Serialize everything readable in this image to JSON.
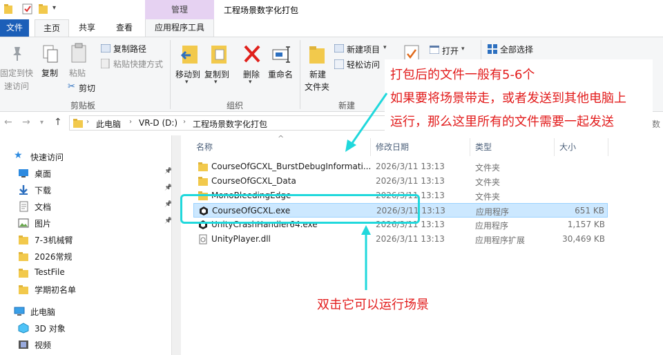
{
  "window": {
    "title": "工程场景数字化打包",
    "context_tab": "管理"
  },
  "ribbon_tabs": {
    "file": "文件",
    "home": "主页",
    "share": "共享",
    "view": "查看",
    "app_tools": "应用程序工具"
  },
  "ribbon": {
    "pin_quick_access": [
      "固定到快",
      "速访问"
    ],
    "copy": "复制",
    "paste": "粘贴",
    "copy_path": "复制路径",
    "paste_shortcut": "粘贴快捷方式",
    "cut": "剪切",
    "clipboard_group": "剪贴板",
    "move_to": "移动到",
    "copy_to": "复制到",
    "delete": "删除",
    "rename": "重命名",
    "organize_group": "组织",
    "new_folder": [
      "新建",
      "文件夹"
    ],
    "new_item": "新建项目",
    "easy_access": "轻松访问",
    "new_group": "新建",
    "open": "打开",
    "select_all": "全部选择"
  },
  "address": {
    "crumbs": [
      "此电脑",
      "VR-D (D:)",
      "工程场景数字化打包"
    ],
    "search_peek": "数"
  },
  "nav": {
    "quick_access": "快速访问",
    "items": [
      {
        "label": "桌面",
        "pinned": true
      },
      {
        "label": "下载",
        "pinned": true
      },
      {
        "label": "文档",
        "pinned": true
      },
      {
        "label": "图片",
        "pinned": true
      },
      {
        "label": "7-3机械臂",
        "pinned": false
      },
      {
        "label": "2026常规",
        "pinned": false
      },
      {
        "label": "TestFile",
        "pinned": false
      },
      {
        "label": "学期初名单",
        "pinned": false
      }
    ],
    "this_pc": "此电脑",
    "pc_items": [
      {
        "label": "3D 对象"
      },
      {
        "label": "视频"
      }
    ]
  },
  "columns": {
    "name": "名称",
    "date": "修改日期",
    "type": "类型",
    "size": "大小"
  },
  "files": [
    {
      "name": "CourseOfGCXL_BurstDebugInformati...",
      "date": "2026/3/11 13:13",
      "type": "文件夹",
      "size": "",
      "kind": "folder"
    },
    {
      "name": "CourseOfGCXL_Data",
      "date": "2026/3/11 13:13",
      "type": "文件夹",
      "size": "",
      "kind": "folder"
    },
    {
      "name": "MonoBleedingEdge",
      "date": "2026/3/11 13:13",
      "type": "文件夹",
      "size": "",
      "kind": "folder"
    },
    {
      "name": "CourseOfGCXL.exe",
      "date": "2026/3/11 13:13",
      "type": "应用程序",
      "size": "651 KB",
      "kind": "unity-exe"
    },
    {
      "name": "UnityCrashHandler64.exe",
      "date": "2026/3/11 13:13",
      "type": "应用程序",
      "size": "1,157 KB",
      "kind": "unity-exe"
    },
    {
      "name": "UnityPlayer.dll",
      "date": "2026/3/11 13:13",
      "type": "应用程序扩展",
      "size": "30,469 KB",
      "kind": "dll"
    }
  ],
  "annotations": {
    "note_lines": [
      "打包后的文件一般有5-6个",
      "如果要将场景带走，或者发送到其他电脑上",
      "运行，那么这里所有的文件需要一起发送"
    ],
    "bottom_note": "双击它可以运行场景",
    "highlight_color": "#20d8dc",
    "text_color": "#e21b1b"
  }
}
